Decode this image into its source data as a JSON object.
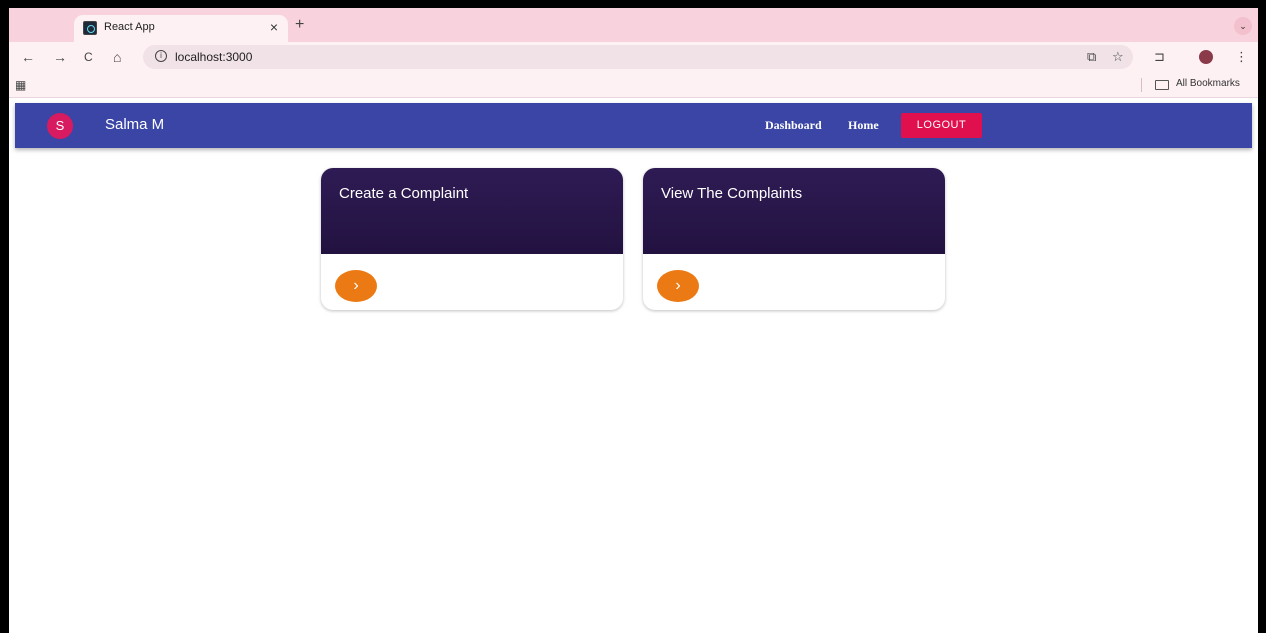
{
  "browser": {
    "tab_title": "React App",
    "tab_close": "×",
    "new_tab": "+",
    "tab_menu": "⌄",
    "url": "localhost:3000",
    "bookmarks_label": "All Bookmarks",
    "nav": {
      "back": "←",
      "forward": "→",
      "reload": "C",
      "home": "⌂"
    },
    "icons": {
      "star": "☆",
      "cast": "⧉",
      "extensions": "⊐",
      "menu": "⋮",
      "apps": "▦"
    }
  },
  "appbar": {
    "avatar_initial": "S",
    "username": "Salma M",
    "links": [
      "Dashboard",
      "Home"
    ],
    "logout_label": "LOGOUT"
  },
  "cards": [
    {
      "title": "Create a Complaint",
      "arrow": "›"
    },
    {
      "title": "View The Complaints",
      "arrow": "›"
    }
  ],
  "colors": {
    "appbar": "#3a45a6",
    "avatar": "#d81b60",
    "logout": "#e0104f",
    "card_header": "#2f1b54",
    "card_arrow": "#ec7a14"
  }
}
